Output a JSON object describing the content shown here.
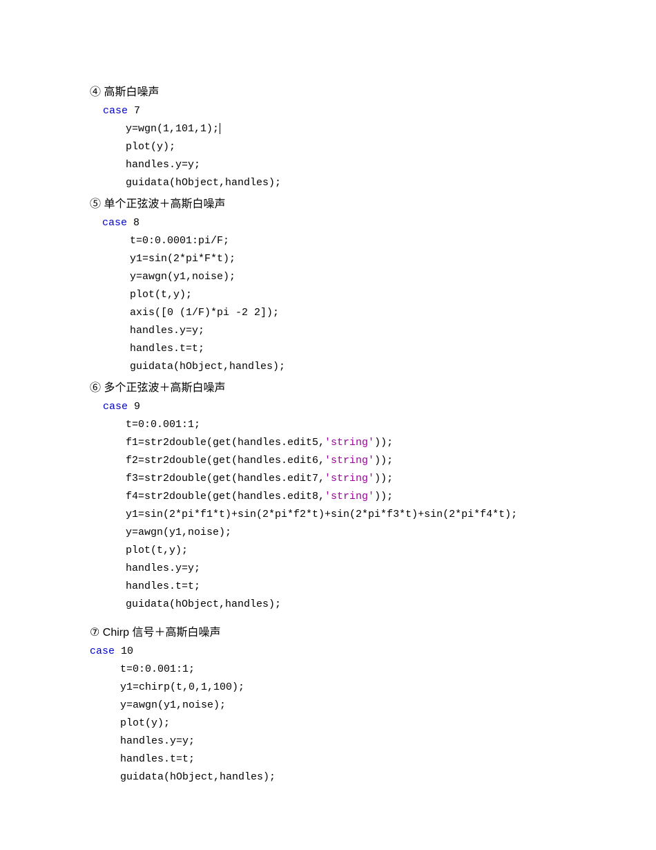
{
  "sections": {
    "s4": {
      "heading": "④ 高斯白噪声",
      "case_kw": "case",
      "case_no": " 7",
      "body": [
        "y=wgn(1,101,1);",
        "plot(y);",
        "handles.y=y;",
        "guidata(hObject,handles);"
      ]
    },
    "s5": {
      "heading": "⑤ 单个正弦波＋高斯白噪声",
      "case_kw": "case",
      "case_no": " 8",
      "body": [
        "t=0:0.0001:pi/F;",
        "y1=sin(2*pi*F*t);",
        "y=awgn(y1,noise);",
        "plot(t,y);",
        "axis([0 (1/F)*pi -2 2]);",
        "handles.y=y;",
        "handles.t=t;",
        "guidata(hObject,handles);"
      ]
    },
    "s6": {
      "heading": "⑥ 多个正弦波＋高斯白噪声",
      "case_kw": "case",
      "case_no": " 9",
      "body_pre": "t=0:0.001:1;",
      "f_lines": [
        {
          "pre": "f1=str2double(get(handles.edit5,",
          "str": "'string'",
          "post": "));"
        },
        {
          "pre": "f2=str2double(get(handles.edit6,",
          "str": "'string'",
          "post": "));"
        },
        {
          "pre": "f3=str2double(get(handles.edit7,",
          "str": "'string'",
          "post": "));"
        },
        {
          "pre": "f4=str2double(get(handles.edit8,",
          "str": "'string'",
          "post": "));"
        }
      ],
      "body_post": [
        "y1=sin(2*pi*f1*t)+sin(2*pi*f2*t)+sin(2*pi*f3*t)+sin(2*pi*f4*t);",
        "y=awgn(y1,noise);",
        "plot(t,y);",
        "handles.y=y;",
        "handles.t=t;",
        "guidata(hObject,handles);"
      ]
    },
    "s7": {
      "heading": "⑦ Chirp 信号＋高斯白噪声",
      "case_kw": "case",
      "case_no": " 10",
      "body": [
        "t=0:0.001:1;",
        "y1=chirp(t,0,1,100);",
        "y=awgn(y1,noise);",
        "plot(y);",
        "handles.y=y;",
        "handles.t=t;",
        "guidata(hObject,handles);"
      ]
    }
  }
}
